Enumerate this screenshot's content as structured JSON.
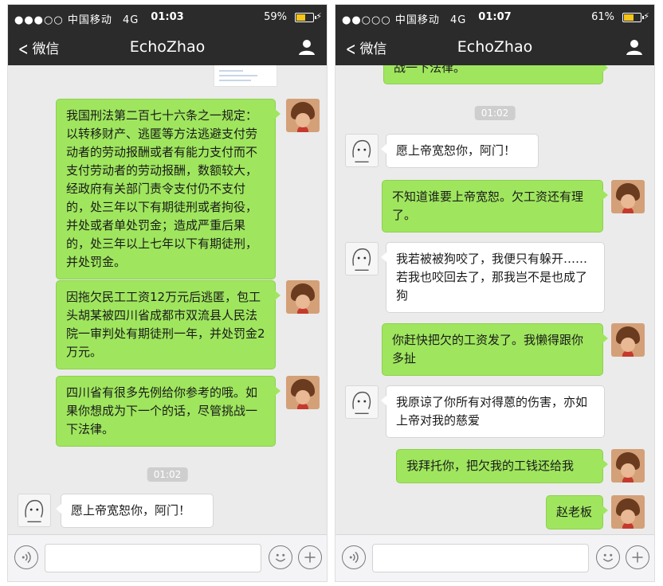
{
  "left_screen": {
    "status": {
      "signal": "●●●○○",
      "carrier": "中国移动",
      "network": "4G",
      "time": "01:03",
      "battery": "59%",
      "battery_level": 0.59
    },
    "nav": {
      "back_label": "微信",
      "title": "EchoZhao"
    },
    "messages": [
      {
        "from": "me",
        "text": "我国刑法第二百七十六条之一规定：以转移财产、逃匿等方法逃避支付劳动者的劳动报酬或者有能力支付而不支付劳动者的劳动报酬，数额较大，经政府有关部门责令支付仍不支付的，处三年以下有期徒刑或者拘役，并处或者单处罚金；造成严重后果的，处三年以上七年以下有期徒刑，并处罚金。"
      },
      {
        "from": "me",
        "text": "因拖欠民工工资12万元后逃匿，包工头胡某被四川省成都市双流县人民法院一审判处有期徒刑一年，并处罚金2万元。"
      },
      {
        "from": "me",
        "text": "四川省有很多先例给你参考的哦。如果你想成为下一个的话，尽管挑战一下法律。"
      },
      {
        "type": "time",
        "text": "01:02"
      },
      {
        "from": "other",
        "text": "愿上帝宽恕你，阿门！"
      }
    ]
  },
  "right_screen": {
    "status": {
      "signal": "●●○○○",
      "carrier": "中国移动",
      "network": "4G",
      "time": "01:07",
      "battery": "61%",
      "battery_level": 0.61
    },
    "nav": {
      "back_label": "微信",
      "title": "EchoZhao"
    },
    "messages": [
      {
        "from": "me",
        "text": "战一下法律。"
      },
      {
        "type": "time",
        "text": "01:02"
      },
      {
        "from": "other",
        "text": "愿上帝宽恕你，阿门！"
      },
      {
        "from": "me",
        "text": "不知道谁要上帝宽恕。欠工资还有理了。"
      },
      {
        "from": "other",
        "text": "我若被被狗咬了，我便只有躲开……若我也咬回去了，那我岂不是也成了狗"
      },
      {
        "from": "me",
        "text": "你赶快把欠的工资发了。我懒得跟你多扯"
      },
      {
        "from": "other",
        "text": "我原谅了你所有对得蒽的伤害，亦如上帝对我的慈爱"
      },
      {
        "from": "me",
        "text": "我拜托你，把欠我的工钱还给我"
      },
      {
        "from": "me",
        "text": "赵老板"
      }
    ]
  },
  "icons": {
    "back": "chevron-left-icon",
    "contact": "person-icon",
    "voice": "voice-icon",
    "emoji": "emoji-icon",
    "more": "plus-icon"
  },
  "colors": {
    "nav_bg": "#2b2b2b",
    "chat_bg": "#ebebeb",
    "sent_bubble": "#9fe65e",
    "received_bubble": "#ffffff",
    "battery": "#f5c518"
  }
}
